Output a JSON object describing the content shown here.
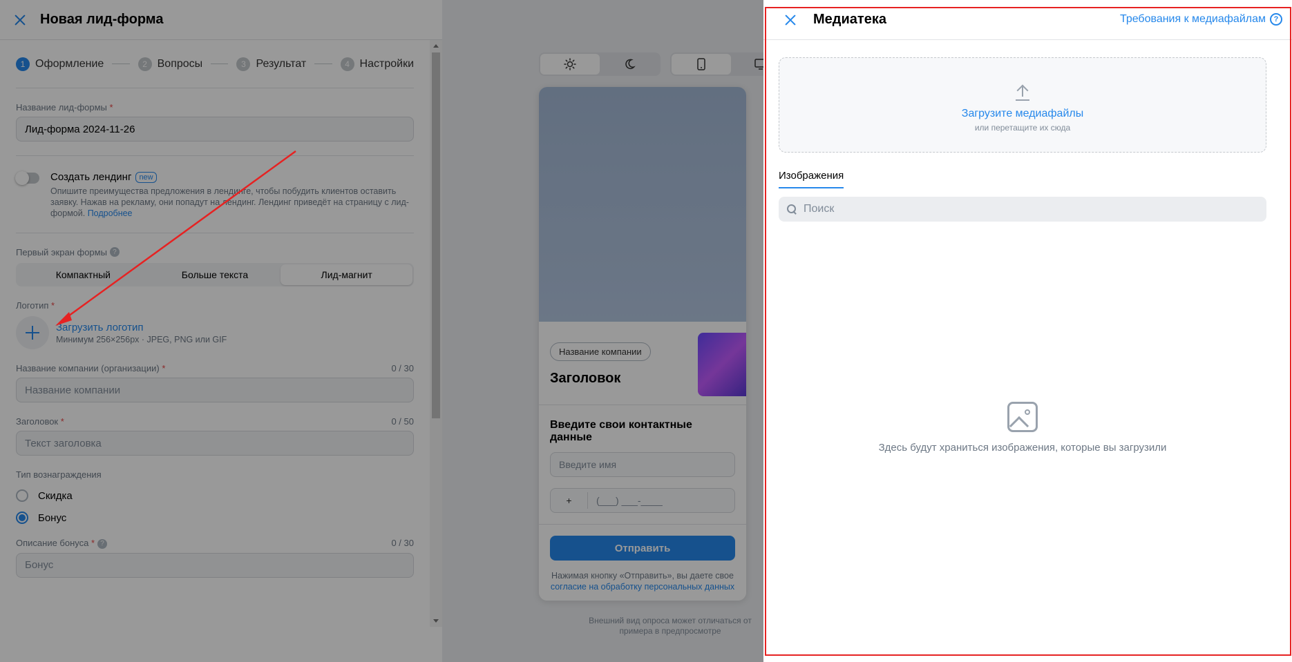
{
  "editor": {
    "title": "Новая лид-форма",
    "steps": [
      {
        "num": "1",
        "label": "Оформление"
      },
      {
        "num": "2",
        "label": "Вопросы"
      },
      {
        "num": "3",
        "label": "Результат"
      },
      {
        "num": "4",
        "label": "Настройки"
      }
    ],
    "form_name": {
      "label": "Название лид-формы",
      "required": "*",
      "value": "Лид-форма 2024-11-26"
    },
    "landing": {
      "title": "Создать лендинг",
      "badge": "new",
      "desc": "Опишите преимущества предложения в лендинге, чтобы побудить клиентов оставить заявку. Нажав на рекламу, они попадут на лендинг. Лендинг приведёт на страницу с лид-формой.",
      "more": "Подробнее"
    },
    "first_screen": {
      "label": "Первый экран формы",
      "help": "?",
      "options": [
        "Компактный",
        "Больше текста",
        "Лид-магнит"
      ]
    },
    "logo": {
      "label": "Логотип",
      "required": "*",
      "link": "Загрузить логотип",
      "hint": "Минимум 256×256px · JPEG, PNG или GIF"
    },
    "company": {
      "label": "Название компании (организации)",
      "required": "*",
      "counter": "0 / 30",
      "placeholder": "Название компании"
    },
    "heading": {
      "label": "Заголовок",
      "required": "*",
      "counter": "0 / 50",
      "placeholder": "Текст заголовка"
    },
    "reward": {
      "label": "Тип вознаграждения",
      "options": [
        "Скидка",
        "Бонус"
      ],
      "selected": "Бонус"
    },
    "bonus": {
      "label": "Описание бонуса",
      "required": "*",
      "help": "?",
      "counter": "0 / 30",
      "placeholder": "Бонус"
    }
  },
  "preview": {
    "company_chip": "Название компании",
    "title": "Заголовок",
    "subtitle": "Введите свои контактные данные",
    "name_placeholder": "Введите имя",
    "phone_code": "+",
    "phone_mask": "(___) ___-____",
    "submit": "Отправить",
    "consent_text": "Нажимая кнопку «Отправить», вы даете свое",
    "consent_link": "согласие на обработку персональных данных",
    "note": "Внешний вид опроса может отличаться от примера в предпросмотре"
  },
  "media": {
    "title": "Медиатека",
    "requirements": "Требования к медиафайлам",
    "upload_link": "Загрузите медиафайлы",
    "upload_hint": "или перетащите их сюда",
    "tab": "Изображения",
    "search_placeholder": "Поиск",
    "empty_text": "Здесь будут храниться изображения, которые вы загрузили"
  },
  "colors": {
    "accent": "#2688eb",
    "annotation": "#e62222"
  }
}
